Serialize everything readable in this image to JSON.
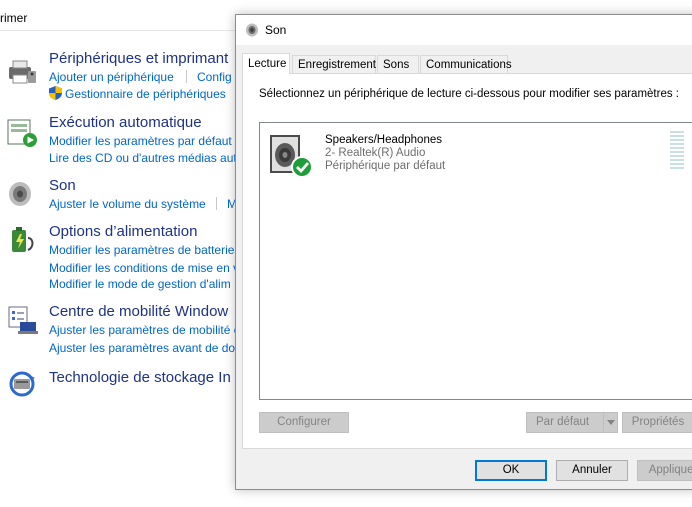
{
  "background": {
    "top_label": "rimer",
    "sections": [
      {
        "title": "Périphériques et imprimant",
        "icon": "printer-icon",
        "links": [
          "Ajouter un périphérique",
          "Config",
          "Gestionnaire de périphériques"
        ]
      },
      {
        "title": "Exécution automatique",
        "icon": "autoplay-icon",
        "links": [
          "Modifier les paramètres par défaut p",
          "Lire des CD ou d'autres médias autc"
        ]
      },
      {
        "title": "Son",
        "icon": "sound-icon",
        "links": [
          "Ajuster le volume du système",
          "M"
        ]
      },
      {
        "title": "Options d’alimentation",
        "icon": "power-options-icon",
        "links": [
          "Modifier les paramètres de batteries",
          "Modifier les conditions de mise en v",
          "Modifier le mode de gestion d'alim"
        ]
      },
      {
        "title": "Centre de mobilité Window",
        "icon": "mobility-center-icon",
        "links": [
          "Ajuster les paramètres de mobilité c",
          "Ajuster les paramètres avant de don"
        ]
      },
      {
        "title": "Technologie de stockage In",
        "icon": "storage-icon",
        "links": []
      }
    ]
  },
  "dialog": {
    "title": "Son",
    "tabs": [
      "Lecture",
      "Enregistrement",
      "Sons",
      "Communications"
    ],
    "active_tab": "Lecture",
    "instruction": "Sélectionnez un périphérique de lecture ci-dessous pour modifier ses paramètres :",
    "device": {
      "name": "Speakers/Headphones",
      "driver": "2- Realtek(R) Audio",
      "status": "Périphérique par défaut"
    },
    "buttons": {
      "configure": "Configurer",
      "set_default": "Par défaut",
      "properties": "Propriétés",
      "ok": "OK",
      "cancel": "Annuler",
      "apply": "Appliquer"
    }
  },
  "colors": {
    "link": "#0066cc",
    "section_title": "#1e3287",
    "accent": "#0078d7",
    "check_green": "#1e9e3a"
  }
}
